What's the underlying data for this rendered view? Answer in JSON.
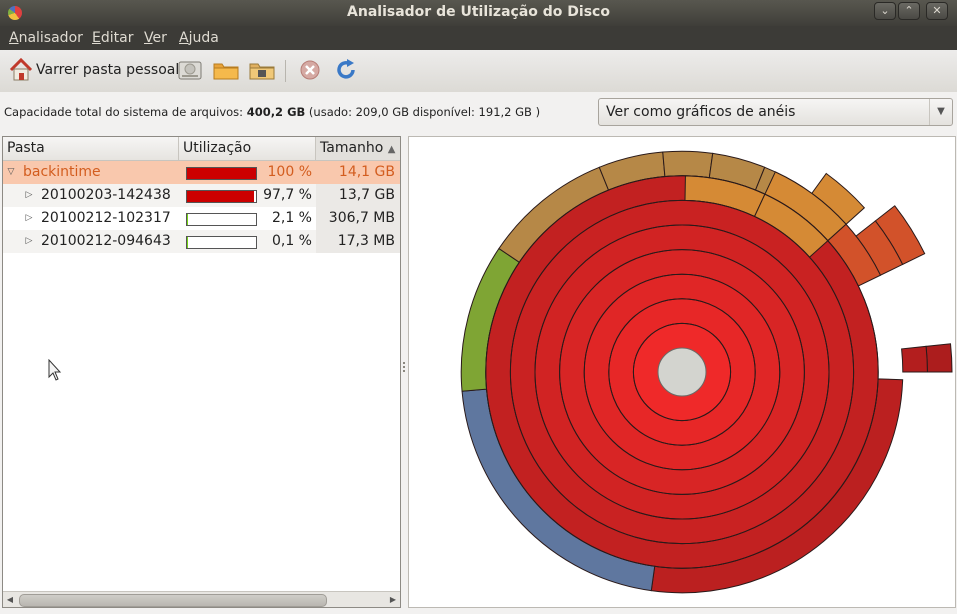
{
  "window": {
    "title": "Analisador de Utilização do Disco",
    "controls": [
      "minimize-icon",
      "maximize-icon",
      "close-icon"
    ]
  },
  "menu": [
    {
      "label": "Analisador",
      "accel": "A",
      "rest": "nalisador"
    },
    {
      "label": "Editar",
      "accel": "E",
      "rest": "ditar"
    },
    {
      "label": "Ver",
      "accel": "V",
      "rest": "er"
    },
    {
      "label": "Ajuda",
      "accel": "A",
      "rest": "juda"
    }
  ],
  "toolbar": {
    "scan_home_label": "Varrer pasta pessoal",
    "icons": [
      "home-icon",
      "drive-icon",
      "folder-icon",
      "remote-folder-icon",
      "stop-icon",
      "refresh-icon"
    ]
  },
  "capacity": {
    "prefix": "Capacidade total do sistema de arquivos: ",
    "total": "400,2 GB",
    "detail": " (usado: 209,0 GB disponível: 191,2 GB )"
  },
  "view_combo": {
    "selected": "Ver como gráficos de anéis"
  },
  "tree": {
    "columns": [
      "Pasta",
      "Utilização",
      "Tamanho"
    ],
    "sort_indicator": "▲",
    "rows": [
      {
        "name": "backintime",
        "usage_pct": 100,
        "usage_text": "100 %",
        "size": "14,1 GB",
        "expanded": true,
        "level": 0,
        "selected": true
      },
      {
        "name": "20100203-142438",
        "usage_pct": 97.7,
        "usage_text": "97,7 %",
        "size": "13,7 GB",
        "expanded": false,
        "level": 1,
        "selected": false
      },
      {
        "name": "20100212-102317",
        "usage_pct": 2.1,
        "usage_text": "2,1 %",
        "size": "306,7 MB",
        "expanded": false,
        "level": 1,
        "selected": false
      },
      {
        "name": "20100212-094643",
        "usage_pct": 0.1,
        "usage_text": "0,1 %",
        "size": "17,3 MB",
        "expanded": false,
        "level": 1,
        "selected": false
      }
    ]
  },
  "colors": {
    "selection": "#f9c8ad",
    "selection_text": "#d35d1f",
    "bar_high": "#cc0000",
    "bar_low": "#73d216",
    "ring_red": "#d42424",
    "ring_green": "#7fa534",
    "ring_blue": "#5f779f",
    "ring_orange": "#d58a35",
    "ring_brown": "#b68847",
    "ring_redorange": "#d2522a",
    "center": "#d3d4cf"
  },
  "ring_chart": {
    "levels": 8,
    "segments": [
      {
        "level": 1,
        "start": 0,
        "end": 360,
        "color": "ring_red"
      },
      {
        "level": 2,
        "start": 0,
        "end": 360,
        "color": "ring_red"
      },
      {
        "level": 3,
        "start": 0,
        "end": 360,
        "color": "ring_red"
      },
      {
        "level": 4,
        "start": 0,
        "end": 360,
        "color": "ring_red"
      },
      {
        "level": 5,
        "start": 0,
        "end": 360,
        "color": "ring_red"
      },
      {
        "level": 6,
        "start": 0,
        "end": 360,
        "color": "ring_red"
      },
      {
        "level": 7,
        "start": 0,
        "end": 360,
        "color": "ring_red"
      },
      {
        "level": 8,
        "start": 92,
        "end": 188,
        "color": "ring_red"
      },
      {
        "level": 8,
        "start": 188,
        "end": 265,
        "color": "ring_blue"
      },
      {
        "level": 8,
        "start": 265,
        "end": 304,
        "color": "ring_green"
      },
      {
        "level": 8,
        "start": 304,
        "end": 338,
        "color": "ring_brown"
      },
      {
        "level": 8,
        "start": 338,
        "end": 355,
        "color": "ring_brown"
      },
      {
        "level": 8,
        "start": 355,
        "end": 8,
        "color": "ring_brown"
      },
      {
        "level": 8,
        "start": 8,
        "end": 22,
        "color": "ring_brown"
      },
      {
        "level": 8,
        "start": 22,
        "end": 28,
        "color": "ring_brown"
      },
      {
        "level": 8,
        "start": 28,
        "end": 33,
        "color": "ring_brown"
      },
      {
        "level": 7,
        "start": 1,
        "end": 25,
        "color": "ring_orange"
      },
      {
        "level": 7,
        "start": 25,
        "end": 48,
        "color": "ring_orange"
      },
      {
        "level": 8,
        "start": 25,
        "end": 48,
        "color": "ring_orange"
      },
      {
        "level": 9,
        "start": 36,
        "end": 48,
        "color": "ring_orange"
      },
      {
        "level": 8,
        "start": 48,
        "end": 64,
        "color": "ring_redorange"
      },
      {
        "level": 9,
        "start": 52,
        "end": 64,
        "color": "ring_redorange"
      },
      {
        "level": 10,
        "start": 52,
        "end": 64,
        "color": "ring_redorange"
      },
      {
        "level": 9,
        "start": 84,
        "end": 90,
        "color": "ring_red"
      },
      {
        "level": 10,
        "start": 84,
        "end": 90,
        "color": "ring_red"
      }
    ]
  }
}
